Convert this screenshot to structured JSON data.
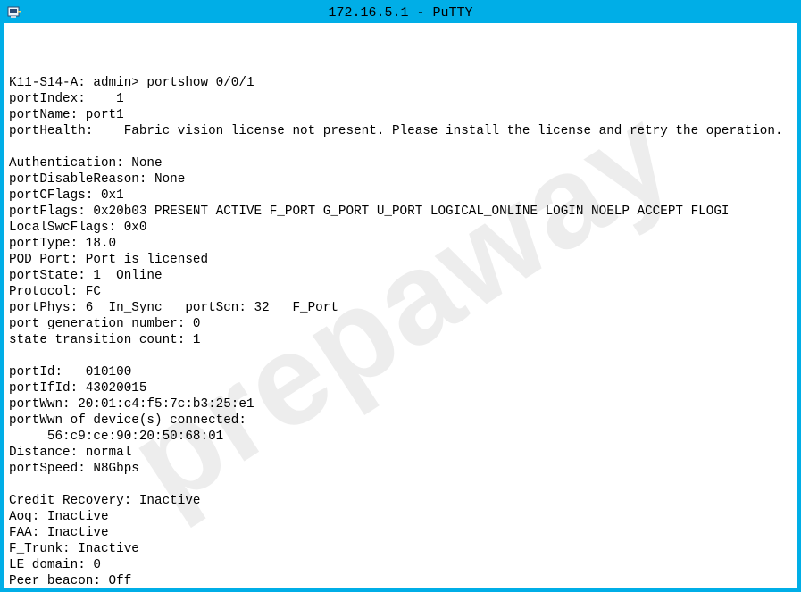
{
  "window": {
    "title": "172.16.5.1 - PuTTY"
  },
  "watermark": "prepaway",
  "prompt": {
    "host": "K11-S14-A",
    "user": "admin",
    "command": "portshow 0/0/1"
  },
  "lines": [
    "K11-S14-A: admin> portshow 0/0/1",
    "portIndex:    1",
    "portName: port1",
    "portHealth:    Fabric vision license not present. Please install the license and retry the operation.",
    "",
    "Authentication: None",
    "portDisableReason: None",
    "portCFlags: 0x1",
    "portFlags: 0x20b03 PRESENT ACTIVE F_PORT G_PORT U_PORT LOGICAL_ONLINE LOGIN NOELP ACCEPT FLOGI",
    "LocalSwcFlags: 0x0",
    "portType: 18.0",
    "POD Port: Port is licensed",
    "portState: 1  Online",
    "Protocol: FC",
    "portPhys: 6  In_Sync   portScn: 32   F_Port",
    "port generation number: 0",
    "state transition count: 1",
    "",
    "portId:   010100",
    "portIfId: 43020015",
    "portWwn: 20:01:c4:f5:7c:b3:25:e1",
    "portWwn of device(s) connected:",
    "     56:c9:ce:90:20:50:68:01",
    "Distance: normal",
    "portSpeed: N8Gbps",
    "",
    "Credit Recovery: Inactive",
    "Aoq: Inactive",
    "FAA: Inactive",
    "F_Trunk: Inactive",
    "LE domain: 0",
    "Peer beacon: Off"
  ],
  "parsed": {
    "portIndex": 1,
    "portName": "port1",
    "portHealth": "Fabric vision license not present. Please install the license and retry the operation.",
    "Authentication": "None",
    "portDisableReason": "None",
    "portCFlags": "0x1",
    "portFlags": "0x20b03 PRESENT ACTIVE F_PORT G_PORT U_PORT LOGICAL_ONLINE LOGIN NOELP ACCEPT FLOGI",
    "LocalSwcFlags": "0x0",
    "portType": "18.0",
    "PODPort": "Port is licensed",
    "portState": "1  Online",
    "Protocol": "FC",
    "portPhys": "6  In_Sync",
    "portScn": "32   F_Port",
    "portGenerationNumber": 0,
    "stateTransitionCount": 1,
    "portId": "010100",
    "portIfId": "43020015",
    "portWwn": "20:01:c4:f5:7c:b3:25:e1",
    "connectedDeviceWwn": "56:c9:ce:90:20:50:68:01",
    "Distance": "normal",
    "portSpeed": "N8Gbps",
    "CreditRecovery": "Inactive",
    "Aoq": "Inactive",
    "FAA": "Inactive",
    "F_Trunk": "Inactive",
    "LEdomain": 0,
    "PeerBeacon": "Off"
  }
}
